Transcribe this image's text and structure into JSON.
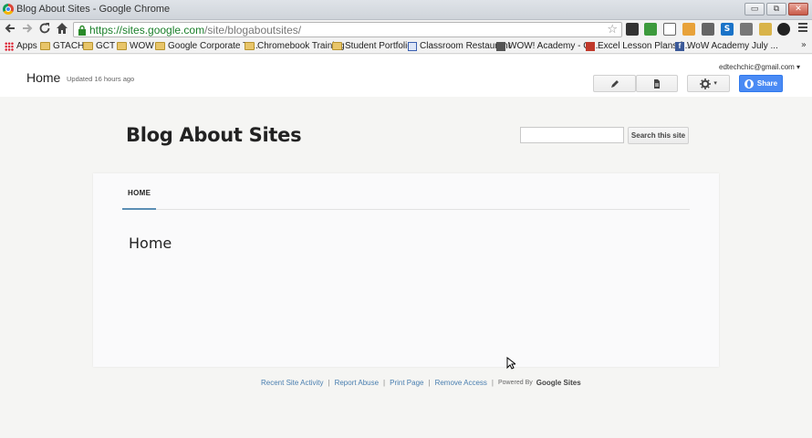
{
  "browser": {
    "window_title": "Blog About Sites - Google Chrome",
    "window_buttons": [
      "▭",
      "⧉",
      "✕"
    ],
    "url_host": "https://sites.google.com",
    "url_path": "/site/blogaboutsites/",
    "extension_labels": [
      "S"
    ]
  },
  "bookmarks": [
    {
      "label": "Apps",
      "icon": "apps-icon"
    },
    {
      "label": "GTACHI",
      "icon": "folder-icon"
    },
    {
      "label": "GCT",
      "icon": "folder-icon"
    },
    {
      "label": "WOW",
      "icon": "folder-icon"
    },
    {
      "label": "Google Corporate Tr...",
      "icon": "folder-icon"
    },
    {
      "label": "Chromebook Training",
      "icon": "folder-icon"
    },
    {
      "label": "Student Portfolios",
      "icon": "folder-icon"
    },
    {
      "label": "Classroom Restaurant",
      "icon": "page-icon"
    },
    {
      "label": "WOW! Academy - G...",
      "icon": "wow-icon"
    },
    {
      "label": "Excel Lesson Plans f...",
      "icon": "excel-icon"
    },
    {
      "label": "WoW Academy July ...",
      "icon": "facebook-icon"
    }
  ],
  "bookmarks_more": "»",
  "sites_header": {
    "page_name": "Home",
    "updated": "Updated 16 hours ago",
    "account": "edtechchic@gmail.com",
    "share_label": "Share"
  },
  "site": {
    "title": "Blog About Sites",
    "search_value": "",
    "search_button": "Search this site",
    "nav_items": [
      "HOME"
    ],
    "page_heading": "Home"
  },
  "footer": {
    "links": [
      "Recent Site Activity",
      "Report Abuse",
      "Print Page",
      "Remove Access"
    ],
    "powered_by": "Powered By",
    "google_sites": "Google Sites"
  }
}
